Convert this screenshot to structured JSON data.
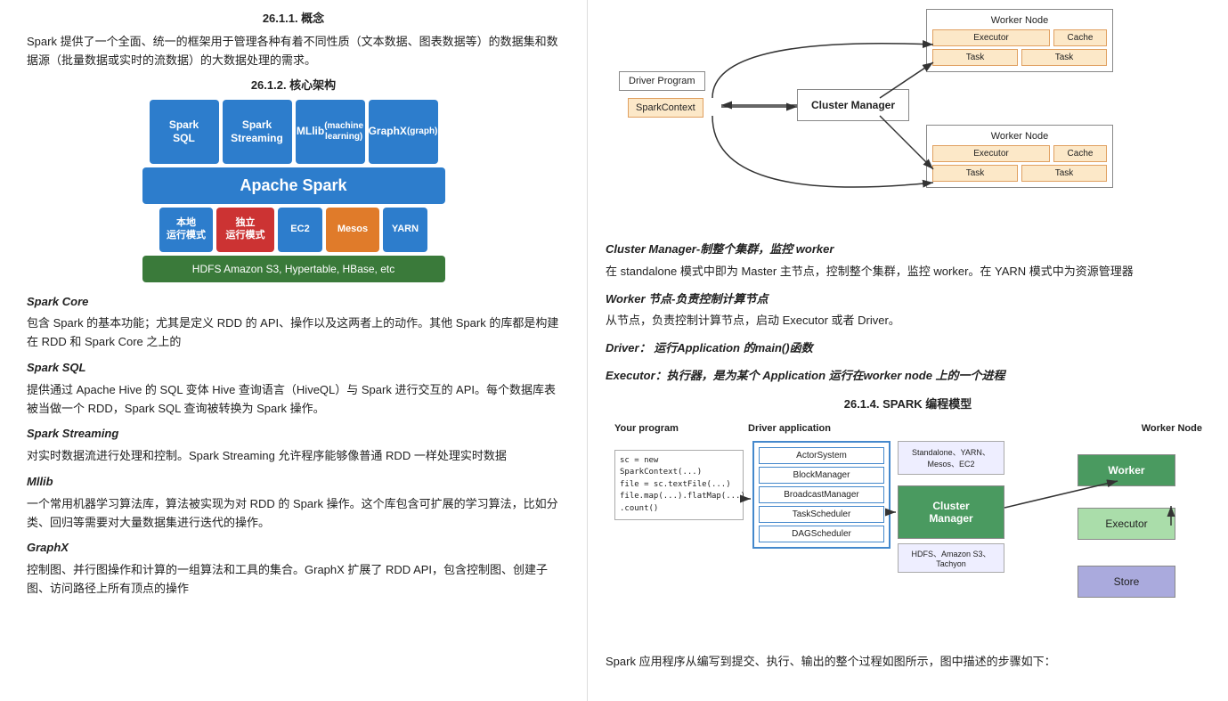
{
  "left": {
    "section1": {
      "title": "26.1.1.   概念",
      "paragraph": "Spark 提供了一个全面、统一的框架用于管理各种有着不同性质（文本数据、图表数据等）的数据集和数据源（批量数据或实时的流数据）的大数据处理的需求。"
    },
    "section2": {
      "title": "26.1.2.   核心架构"
    },
    "arch_diagram": {
      "row1": [
        {
          "label": "Spark\nSQL",
          "color": "blue"
        },
        {
          "label": "Spark\nStreaming",
          "color": "blue"
        },
        {
          "label": "MLlib\n(machine\nlearning)",
          "color": "blue"
        },
        {
          "label": "GraphX\n(graph)",
          "color": "blue"
        }
      ],
      "apache_spark": "Apache Spark",
      "row2": [
        {
          "label": "本地\n运行模式",
          "color": "blue"
        },
        {
          "label": "独立\n运行模式",
          "color": "red"
        },
        {
          "label": "EC2",
          "color": "blue"
        },
        {
          "label": "Mesos",
          "color": "orange"
        },
        {
          "label": "YARN",
          "color": "blue"
        }
      ],
      "row3": "HDFS     Amazon S3, Hypertable, HBase, etc"
    },
    "spark_core": {
      "title": "Spark Core",
      "text": "包含 Spark 的基本功能；尤其是定义 RDD 的 API、操作以及这两者上的动作。其他 Spark 的库都是构建在 RDD 和 Spark Core 之上的"
    },
    "spark_sql": {
      "title": "Spark SQL",
      "text": "提供通过 Apache Hive 的 SQL 变体 Hive 查询语言（HiveQL）与 Spark 进行交互的 API。每个数据库表被当做一个 RDD，Spark SQL 查询被转换为 Spark 操作。"
    },
    "spark_streaming": {
      "title": "Spark Streaming",
      "text": "对实时数据流进行处理和控制。Spark Streaming 允许程序能够像普通 RDD 一样处理实时数据"
    },
    "mllib": {
      "title": "Mllib",
      "text": "一个常用机器学习算法库，算法被实现为对 RDD 的 Spark 操作。这个库包含可扩展的学习算法，比如分类、回归等需要对大量数据集进行迭代的操作。"
    },
    "graphx": {
      "title": "GraphX",
      "text": "控制图、并行图操作和计算的一组算法和工具的集合。GraphX 扩展了 RDD API，包含控制图、创建子图、访问路径上所有顶点的操作"
    }
  },
  "right": {
    "cluster_manager": {
      "bold_title": "Cluster Manager-制整个集群，监控 worker",
      "text": "在 standalone 模式中即为 Master 主节点，控制整个集群，监控 worker。在 YARN 模式中为资源管理器"
    },
    "worker": {
      "bold_title": "Worker 节点-负责控制计算节点",
      "text": "从节点，负责控制计算节点，启动 Executor 或者 Driver。"
    },
    "driver": {
      "bold_title": "Driver：  运行Application 的main()函数",
      "text": ""
    },
    "executor": {
      "bold_title": "Executor：执行器，是为某个 Application 运行在worker node 上的一个进程",
      "text": ""
    },
    "section4_title": "26.1.4.    SPARK 编程模型",
    "prog_diagram": {
      "your_program": "Your program",
      "driver_application": "Driver application",
      "worker_node": "Worker Node",
      "code_lines": [
        "sc = new SparkContext(...)",
        "file = sc.textFile(...)",
        "file.map(...).flatMap(...)",
        ".count()"
      ],
      "driver_items": [
        "ActorSystem",
        "BlockManager",
        "BroadcastManager",
        "TaskScheduler",
        "DAGScheduler"
      ],
      "cluster_options": "Standalone、YARN、Mesos、EC2",
      "cluster_manager": "Cluster\nManager",
      "worker_label": "Worker",
      "executor_label": "Executor",
      "store_label": "Store",
      "hdfs_label": "HDFS、Amazon S3、Tachyon"
    },
    "last_text": "Spark 应用程序从编写到提交、执行、输出的整个过程如图所示，图中描述的步骤如下："
  }
}
